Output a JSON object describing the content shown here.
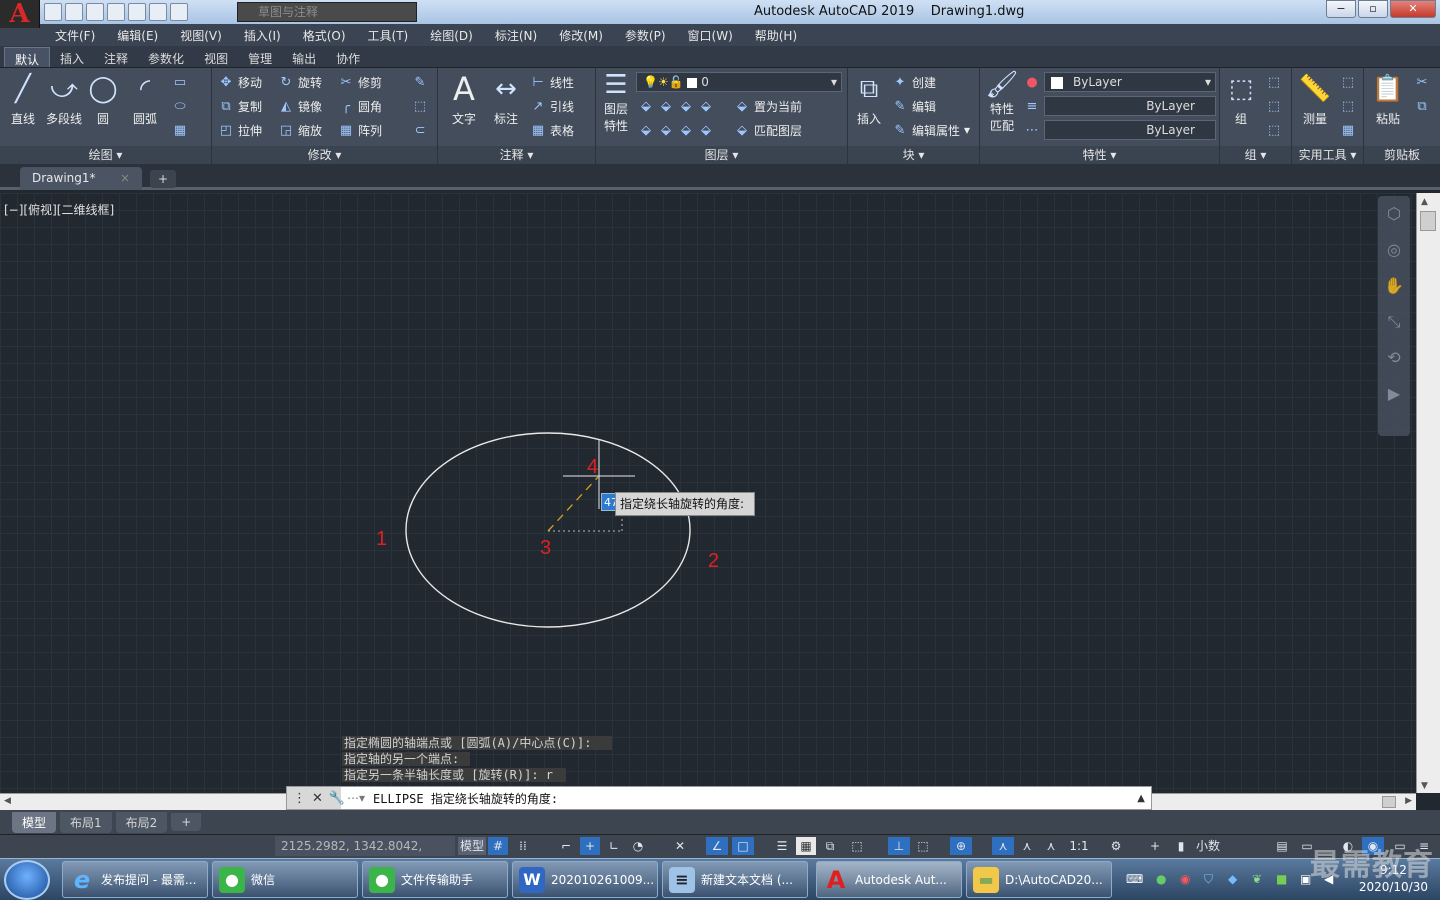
{
  "app": {
    "title": "Autodesk AutoCAD 2019",
    "document": "Drawing1.dwg",
    "logo_letter": "A",
    "workspace_placeholder": "草图与注释"
  },
  "menu": [
    "文件(F)",
    "编辑(E)",
    "视图(V)",
    "插入(I)",
    "格式(O)",
    "工具(T)",
    "绘图(D)",
    "标注(N)",
    "修改(M)",
    "参数(P)",
    "窗口(W)",
    "帮助(H)"
  ],
  "ribbon_tabs": [
    "默认",
    "插入",
    "注释",
    "参数化",
    "视图",
    "管理",
    "输出",
    "协作"
  ],
  "ribbon": {
    "draw": {
      "title": "绘图",
      "line": "直线",
      "polyline": "多段线",
      "circle": "圆",
      "arc": "圆弧"
    },
    "modify": {
      "title": "修改",
      "move": "移动",
      "rotate": "旋转",
      "trim": "修剪",
      "copy": "复制",
      "mirror": "镜像",
      "fillet": "圆角",
      "stretch": "拉伸",
      "scale": "缩放",
      "array": "阵列"
    },
    "annotation": {
      "title": "注释",
      "text": "文字",
      "dimension": "标注",
      "linear": "线性",
      "leader": "引线",
      "table": "表格"
    },
    "layers": {
      "title": "图层",
      "layer_props_1": "图层",
      "layer_props_2": "特性",
      "current_layer": "0",
      "set_current": "置为当前",
      "match_layer": "匹配图层"
    },
    "block": {
      "title": "块",
      "insert": "插入",
      "create": "创建",
      "edit": "编辑",
      "edit_attr": "编辑属性"
    },
    "properties": {
      "title": "特性",
      "match_1": "特性",
      "match_2": "匹配",
      "color": "ByLayer",
      "linetype": "ByLayer",
      "lineweight": "ByLayer"
    },
    "group": {
      "title": "组",
      "group": "组"
    },
    "utilities": {
      "title": "实用工具",
      "measure": "测量"
    },
    "clipboard": {
      "title": "剪贴板",
      "paste": "粘贴"
    }
  },
  "doc_tab": "Drawing1*",
  "viewport_label": "[−][俯视][二维线框]",
  "drawing": {
    "labels": [
      "1",
      "2",
      "3",
      "4"
    ],
    "tooltip": "指定绕长轴旋转的角度:",
    "input_value": "47"
  },
  "command_history": [
    "指定椭圆的轴端点或 [圆弧(A)/中心点(C)]:",
    "指定轴的另一个端点:",
    "指定另一条半轴长度或 [旋转(R)]: r"
  ],
  "command_line": "ELLIPSE 指定绕长轴旋转的角度:",
  "layout_tabs": [
    "模型",
    "布局1",
    "布局2"
  ],
  "status": {
    "coords": "2125.2982, 1342.8042, 0.0000",
    "model": "模型",
    "scale": "1:1",
    "units": "小数"
  },
  "taskbar": [
    {
      "label": "发布提问 - 最需...",
      "icon": "ie-icon"
    },
    {
      "label": "微信",
      "icon": "wechat-icon"
    },
    {
      "label": "文件传输助手",
      "icon": "wechat-icon"
    },
    {
      "label": "202010261009...",
      "icon": "word-icon"
    },
    {
      "label": "新建文本文档 (...",
      "icon": "notepad-icon"
    },
    {
      "label": "Autodesk Aut...",
      "icon": "autocad-icon"
    },
    {
      "label": "D:\\AutoCAD20...",
      "icon": "folder-icon"
    }
  ],
  "clock": {
    "time": "9:12",
    "date": "2020/10/30"
  },
  "watermark": "最需教育",
  "colors": {
    "canvas": "#212830",
    "ribbon": "#434d5c",
    "label_red": "#e02020",
    "ellipse": "#e8e8e8",
    "axis_line": "#d4a017"
  }
}
